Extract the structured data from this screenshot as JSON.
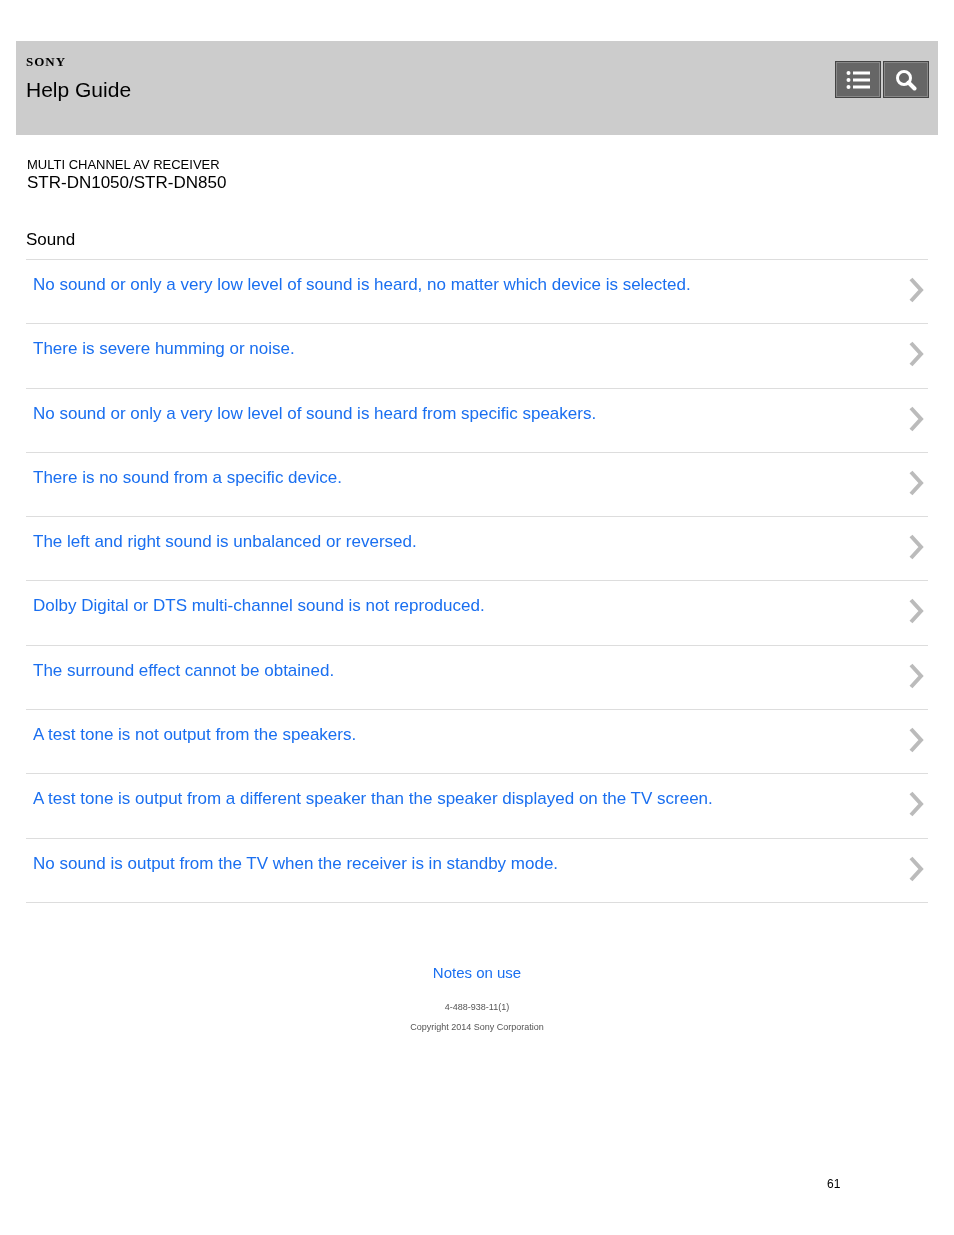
{
  "header": {
    "logo": "SONY",
    "title": "Help Guide"
  },
  "product": {
    "category": "MULTI CHANNEL AV RECEIVER",
    "model": "STR-DN1050/STR-DN850"
  },
  "section": {
    "title": "Sound",
    "items": [
      "No sound or only a very low level of sound is heard, no matter which device is selected.",
      "There is severe humming or noise.",
      "No sound or only a very low level of sound is heard from specific speakers.",
      "There is no sound from a specific device.",
      "The left and right sound is unbalanced or reversed.",
      "Dolby Digital or DTS multi-channel sound is not reproduced.",
      "The surround effect cannot be obtained.",
      "A test tone is not output from the speakers.",
      "A test tone is output from a different speaker than the speaker displayed on the TV screen.",
      "No sound is output from the TV when the receiver is in standby mode."
    ]
  },
  "footer": {
    "link": "Notes on use",
    "code": "4-488-938-11(1)",
    "copyright": "Copyright 2014 Sony Corporation"
  },
  "page_number": "61"
}
